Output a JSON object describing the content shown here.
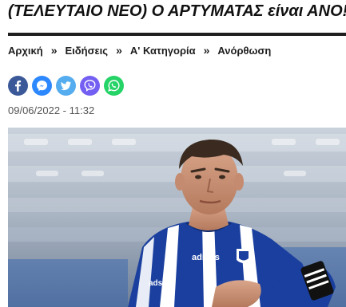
{
  "article": {
    "headline": "(ΤΕΛΕΥΤΑΙΟ ΝΕΟ) Ο ΑΡΤΥΜΑΤΑΣ είναι ΑΝΟ!",
    "date": "09/06/2022 - 11:32"
  },
  "breadcrumb": {
    "items": [
      {
        "label": "Αρχική"
      },
      {
        "label": "Ειδήσεις"
      },
      {
        "label": "Α' Κατηγορία"
      },
      {
        "label": "Ανόρθωση"
      }
    ],
    "separator": "»"
  },
  "share": {
    "buttons": [
      {
        "icon": "facebook-icon",
        "color": "#3b5998"
      },
      {
        "icon": "messenger-icon",
        "color": "#2d88ff"
      },
      {
        "icon": "twitter-icon",
        "color": "#55acee"
      },
      {
        "icon": "viber-icon",
        "color": "#7360f2"
      },
      {
        "icon": "whatsapp-icon",
        "color": "#25d366"
      }
    ]
  },
  "photo": {
    "jersey_brand": "adidas",
    "jersey_sponsor": "ads",
    "colors": {
      "jersey_blue": "#1a3f9e",
      "jersey_white": "#ffffff",
      "stadium_blue": "#2f5fb0"
    }
  }
}
